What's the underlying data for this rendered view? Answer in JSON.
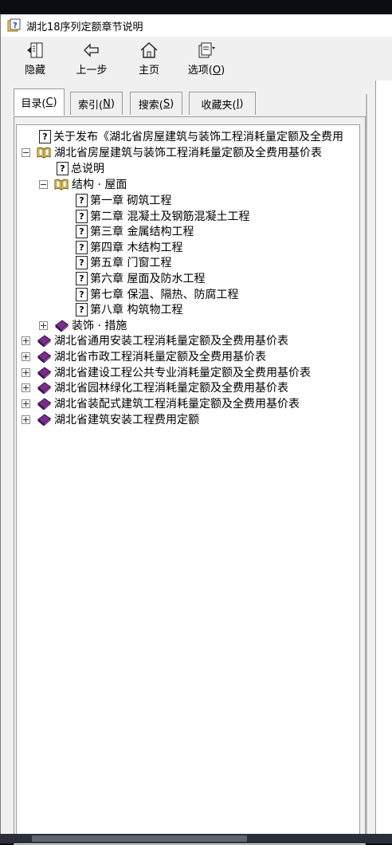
{
  "window": {
    "title": "湖北18序列定额章节说明"
  },
  "toolbar": {
    "hide": {
      "label": "隐藏",
      "icon": "hide-pane-icon"
    },
    "back": {
      "label": "上一步",
      "icon": "back-arrow-icon"
    },
    "home": {
      "label": "主页",
      "icon": "home-icon"
    },
    "options": {
      "label": "选项(",
      "accel": "O",
      "suffix": ")",
      "icon": "options-icon"
    }
  },
  "tabs": [
    {
      "label": "目录(",
      "accel": "C",
      "suffix": ")",
      "active": true
    },
    {
      "label": "索引(",
      "accel": "N",
      "suffix": ")",
      "active": false
    },
    {
      "label": "搜索(",
      "accel": "S",
      "suffix": ")",
      "active": false
    },
    {
      "label": "收藏夹(",
      "accel": "I",
      "suffix": ")",
      "active": false
    }
  ],
  "tree": [
    {
      "text": "关于发布《湖北省房屋建筑与装饰工程消耗量定额及全费用",
      "icon": "help-page-icon"
    },
    {
      "text": "湖北省房屋建筑与装饰工程消耗量定额及全费用基价表",
      "icon": "open-book-icon",
      "expanded": true
    },
    {
      "text": "总说明",
      "icon": "help-page-icon"
    },
    {
      "text": "结构 · 屋面",
      "icon": "open-book-icon",
      "expanded": true
    },
    {
      "text": "第一章  砌筑工程",
      "icon": "help-page-icon"
    },
    {
      "text": "第二章  混凝土及钢筋混凝土工程",
      "icon": "help-page-icon"
    },
    {
      "text": "第三章  金属结构工程",
      "icon": "help-page-icon"
    },
    {
      "text": "第四章  木结构工程",
      "icon": "help-page-icon"
    },
    {
      "text": "第五章  门窗工程",
      "icon": "help-page-icon"
    },
    {
      "text": "第六章  屋面及防水工程",
      "icon": "help-page-icon"
    },
    {
      "text": "第七章  保温、隔热、防腐工程",
      "icon": "help-page-icon"
    },
    {
      "text": "第八章  构筑物工程",
      "icon": "help-page-icon"
    },
    {
      "text": "装饰 · 措施",
      "icon": "closed-book-icon",
      "expanded": false
    },
    {
      "text": "湖北省通用安装工程消耗量定额及全费用基价表",
      "icon": "closed-book-icon",
      "expanded": false
    },
    {
      "text": "湖北省市政工程消耗量定额及全费用基价表",
      "icon": "closed-book-icon",
      "expanded": false
    },
    {
      "text": "湖北省建设工程公共专业消耗量定额及全费用基价表",
      "icon": "closed-book-icon",
      "expanded": false
    },
    {
      "text": "湖北省园林绿化工程消耗量定额及全费用基价表",
      "icon": "closed-book-icon",
      "expanded": false
    },
    {
      "text": "湖北省装配式建筑工程消耗量定额及全费用基价表",
      "icon": "closed-book-icon",
      "expanded": false
    },
    {
      "text": "湖北省建筑安装工程费用定额",
      "icon": "closed-book-icon",
      "expanded": false
    }
  ],
  "colors": {
    "book_closed": "#7b2d8e",
    "book_open": "#e6b400",
    "window_bg": "#f0f0f0"
  }
}
